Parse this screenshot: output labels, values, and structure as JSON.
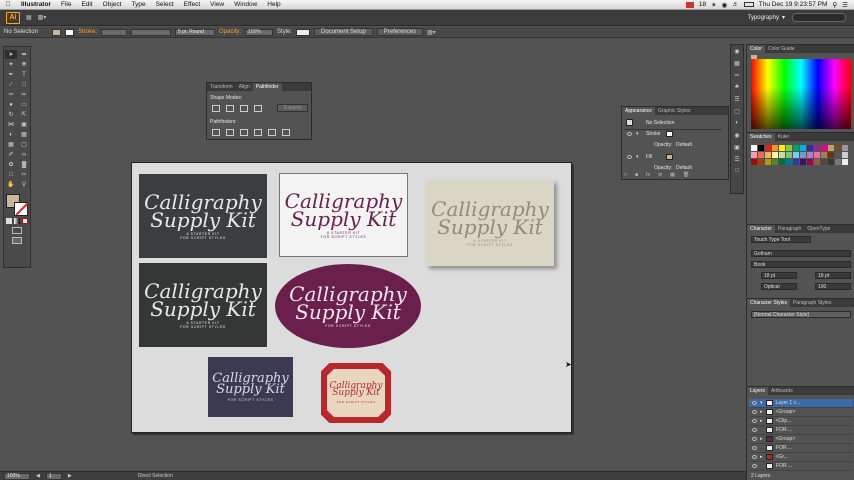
{
  "menubar": {
    "app_name": "Illustrator",
    "items": [
      "File",
      "Edit",
      "Object",
      "Type",
      "Select",
      "Effect",
      "View",
      "Window",
      "Help"
    ],
    "status_number": "18",
    "clock": "Thu Dec 19  9:23:57 PM"
  },
  "appbar": {
    "logo": "Ai",
    "workspace": "Typography"
  },
  "controlbar": {
    "selection": "No Selection",
    "stroke_label": "Stroke:",
    "brush": "5 pt. Round",
    "opacity_label": "Opacity:",
    "opacity_value": "100%",
    "style_label": "Style:",
    "document_setup": "Document Setup",
    "preferences": "Preferences"
  },
  "pathfinder": {
    "tabs": [
      "Transform",
      "Align",
      "Pathfinder"
    ],
    "shape_modes": "Shape Modes:",
    "pathfinders": "Pathfinders:",
    "expand": "Expand"
  },
  "appearance": {
    "tabs": [
      "Appearance",
      "Graphic Styles"
    ],
    "no_selection": "No Selection",
    "stroke": "Stroke",
    "opacity": "Opacity:",
    "opacity_value": "Default",
    "fill": "Fill",
    "opacity2": "Opacity:",
    "opacity2_value": "Default"
  },
  "color_panel": {
    "tabs": [
      "Color",
      "Color Guide"
    ]
  },
  "swatches_panel": {
    "tabs": [
      "Swatches",
      "Kuler"
    ]
  },
  "character_panel": {
    "tabs": [
      "Character",
      "Paragraph",
      "OpenType"
    ],
    "touch_type": "Touch Type Tool",
    "font_family": "Gotham",
    "font_style": "Book",
    "font_size": "18 pt",
    "leading": "18 pt",
    "kerning": "Optical",
    "tracking": "100"
  },
  "character_styles": {
    "tabs": [
      "Character Styles",
      "Paragraph Styles"
    ],
    "item": "[Normal Character Style]"
  },
  "layers": {
    "tabs": [
      "Layers",
      "Artboards"
    ],
    "rows": [
      "Layer 1 c...",
      "<Group>",
      "<Clip...",
      "FOR ...",
      "<Group>",
      "FOR ...",
      "<Gr...",
      "FOR ..."
    ],
    "count": "2 Layers"
  },
  "cards": {
    "line1": "Calligraphy",
    "line2": "Supply Kit",
    "subtitle_a": "A Starter Kit",
    "subtitle_b": "for Script Styles",
    "subtitle_short": "for Script Styles"
  },
  "statusbar": {
    "zoom": "100%",
    "page": "1",
    "tool": "Direct Selection"
  },
  "colors": {
    "accent": "#f0a040",
    "purple": "#6a1f4d",
    "dark_card": "#3b3d3e",
    "cream_card": "#d9d6c6",
    "navy_card": "#3c3a52",
    "red_seal": "#b8272b"
  }
}
